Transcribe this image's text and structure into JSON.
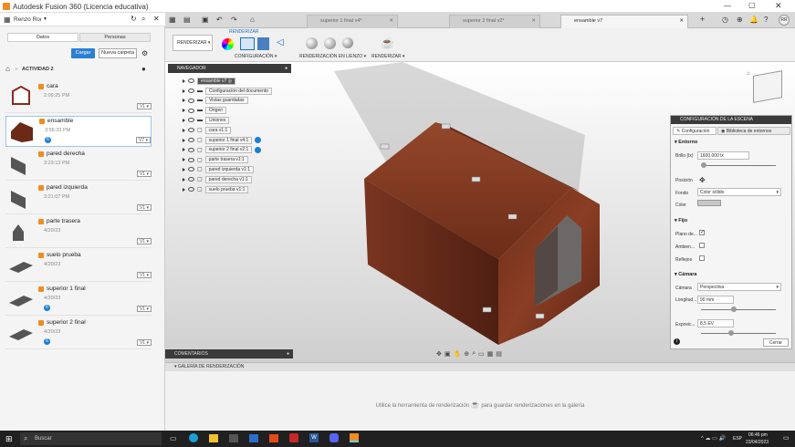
{
  "window": {
    "title": "Autodesk Fusion 360 (Licencia educativa)"
  },
  "left_panel": {
    "project": "Renzo Rodriguez",
    "tabs": [
      "Datos",
      "Personas"
    ],
    "upload_label": "Cargar",
    "new_folder_label": "Nueva carpeta",
    "folder": "ACTIVIDAD 2",
    "files": [
      {
        "name": "cara",
        "date": "2:09:25 PM",
        "version": "V1",
        "badge": ""
      },
      {
        "name": "ensamble",
        "date": "3:56:33 PM",
        "version": "V7",
        "badge": "6"
      },
      {
        "name": "pared derecha",
        "date": "3:23:13 PM",
        "version": "V1",
        "badge": ""
      },
      {
        "name": "pared izquierda",
        "date": "3:21:07 PM",
        "version": "V1",
        "badge": ""
      },
      {
        "name": "parte trasera",
        "date": "4/20/23",
        "version": "V1",
        "badge": ""
      },
      {
        "name": "suelo prueba",
        "date": "4/20/23",
        "version": "V1",
        "badge": ""
      },
      {
        "name": "superior 1 final",
        "date": "4/20/23",
        "version": "V1",
        "badge": "6"
      },
      {
        "name": "superior 2 final",
        "date": "4/20/23",
        "version": "V1",
        "badge": "6"
      }
    ]
  },
  "doc_tabs": [
    "superior 1 final v4*",
    "superior 2 final v2*",
    "ensamble v7"
  ],
  "user_initials": "RR",
  "toolbar": {
    "workspace": "RENDERIZAR",
    "section_label": "RENDERIZAR",
    "groups": [
      "CONFIGURACIÓN",
      "RENDERIZACIÓN EN LIENZO",
      "RENDERIZAR"
    ]
  },
  "browser": {
    "title": "NAVEGADOR",
    "root": "ensamble v7",
    "items": [
      "Configuración del documento",
      "Vistas guardadas",
      "Origen",
      "Uniones",
      "cara v1:1",
      "superior 1 final v4:1",
      "superior 2 final v2:1",
      "parte trasera v1:1",
      "pared izquierda v1:1",
      "pared derecha v1:1",
      "suelo prueba v1:1"
    ]
  },
  "scene": {
    "title": "CONFIGURACIÓN DE LA ESCENA",
    "tabs": [
      "Configuración",
      "Biblioteca de entornos"
    ],
    "env_section": "Entorno",
    "brightness_label": "Brillo (lx)",
    "brightness_value": "1600.000 lx",
    "position_label": "Posición",
    "background_label": "Fondo",
    "background_value": "Color sólido",
    "color_label": "Color",
    "ground_section": "Fijo",
    "ground_flat_label": "Plano de...",
    "ground_ao_label": "Ambien...",
    "ground_reflect_label": "Reflejos",
    "camera_section": "Cámara",
    "camera_label": "Cámara",
    "camera_value": "Perspectiva",
    "focal_label": "Longitud...",
    "focal_value": "90 mm",
    "exposure_label": "Exposic...",
    "exposure_value": "8.5 EV",
    "close_label": "Cerrar"
  },
  "comments_label": "COMENTARIOS",
  "gallery": {
    "title": "GALERÍA DE RENDERIZACIÓN",
    "hint_before": "Utilice la herramienta de renderización",
    "hint_after": "para guardar renderizaciones en la galería"
  },
  "taskbar": {
    "search": "Buscar",
    "time": "06:46 pm",
    "date": "23/04/2023",
    "lang": "ESP"
  }
}
